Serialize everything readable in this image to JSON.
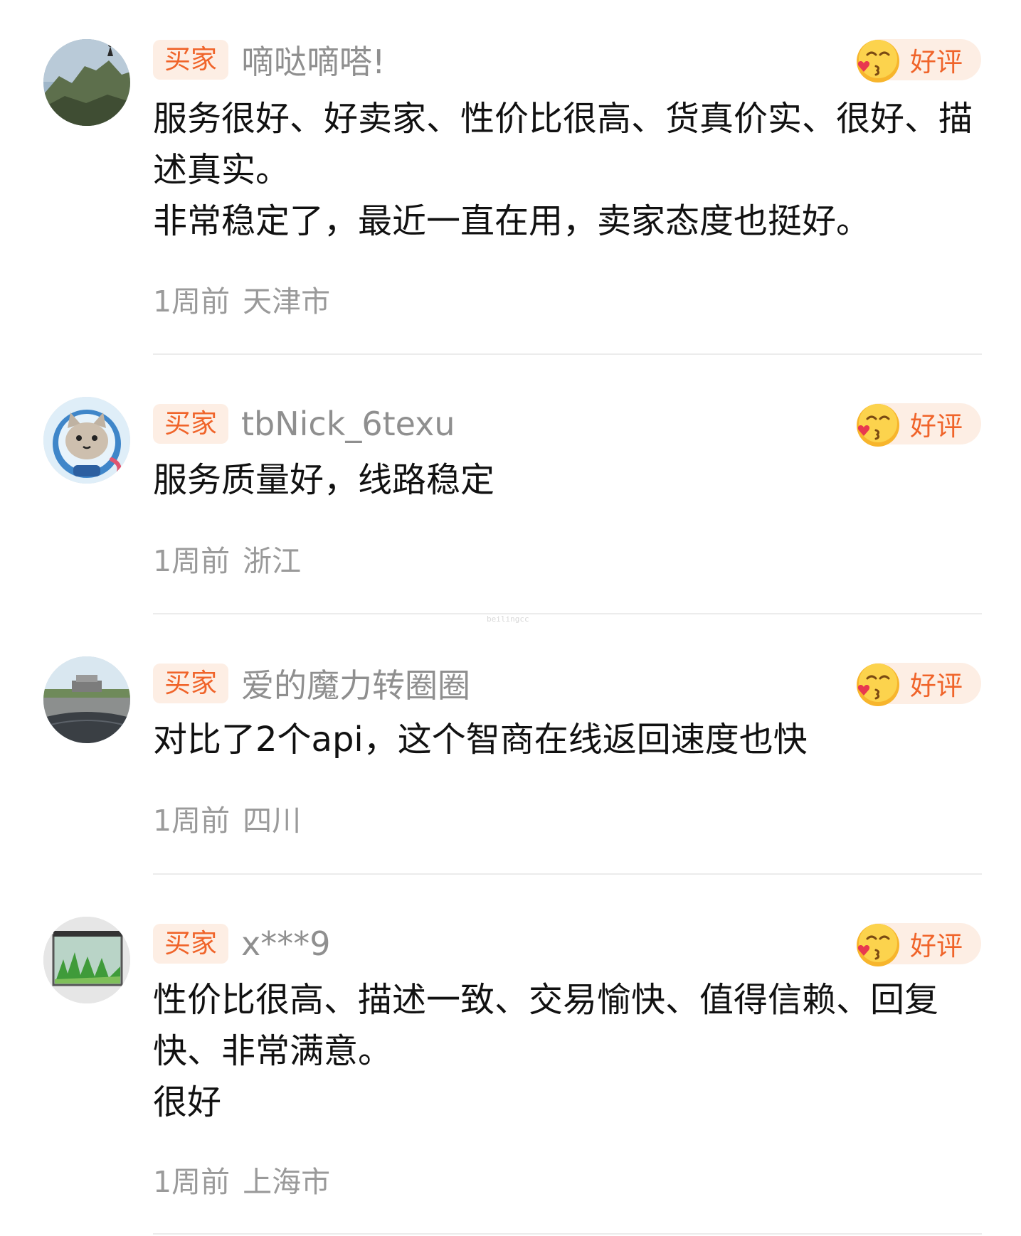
{
  "reviews": [
    {
      "buyer_tag": "买家",
      "nickname": "嘀哒嘀嗒!",
      "rating_label": "好评",
      "rating_icon": "kissing-face-emoji",
      "avatar": "mountain-photo",
      "content_lines": [
        "服务很好、好卖家、性价比很高、货真价实、很好、描述真实。",
        "非常稳定了，最近一直在用，卖家态度也挺好。"
      ],
      "time": "1周前",
      "location": "天津市"
    },
    {
      "buyer_tag": "买家",
      "nickname": "tbNick_6texu",
      "rating_label": "好评",
      "rating_icon": "kissing-face-emoji",
      "avatar": "cartoon-cat-astronaut",
      "content_lines": [
        "服务质量好，线路稳定"
      ],
      "time": "1周前",
      "location": "浙江"
    },
    {
      "buyer_tag": "买家",
      "nickname": "爱的魔力转圈圈",
      "rating_label": "好评",
      "rating_icon": "kissing-face-emoji",
      "avatar": "road-photo",
      "content_lines": [
        "对比了2个api，这个智商在线返回速度也快"
      ],
      "time": "1周前",
      "location": "四川"
    },
    {
      "buyer_tag": "买家",
      "nickname": "x***9",
      "rating_label": "好评",
      "rating_icon": "kissing-face-emoji",
      "avatar": "aquarium-photo",
      "content_lines": [
        "性价比很高、描述一致、交易愉快、值得信赖、回复快、非常满意。",
        "很好"
      ],
      "time": "1周前",
      "location": "上海市"
    }
  ],
  "watermark": "beilingcc",
  "colors": {
    "accent": "#f0642a",
    "tag_background": "#fdeee4",
    "meta_text": "#9a9a9a",
    "nickname_text": "#8f8f8f",
    "divider": "#ececec"
  }
}
